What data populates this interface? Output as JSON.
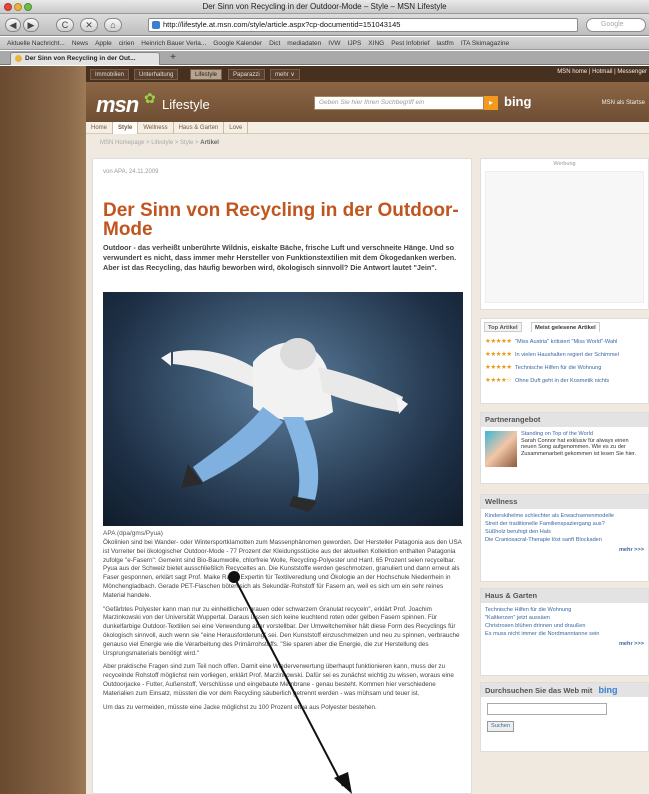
{
  "window": {
    "title": "Der Sinn von Recycling in der Outdoor-Mode – Style – MSN Lifestyle"
  },
  "toolbar": {
    "back": "◀",
    "forward": "▶",
    "reload": "C",
    "stop": "✕",
    "home": "⌂",
    "url": "http://lifestyle.at.msn.com/style/article.aspx?cp-documentid=151043145",
    "search_placeholder": "Google"
  },
  "bookmarks": [
    "Aktuelle Nachricht...",
    "News",
    "Apple",
    "cirien",
    "Heinrich Bauer Verla...",
    "Google Kalender",
    "Dict",
    "mediadaten",
    "IVW",
    "IJPS",
    "XING",
    "Pest Infobrief",
    "lastfm",
    "ITA Skimagazine"
  ],
  "tab": {
    "label": "Der Sinn von Recycling in der Out...",
    "new_tab": "+"
  },
  "msn": {
    "top_nav": [
      "Immobilien",
      "Unterhaltung",
      "Lifestyle",
      "Paparazzi",
      "mehr ∨"
    ],
    "top_right": "MSN home | Hotmail | Messenger",
    "logo": "msn",
    "lifestyle": "Lifestyle",
    "search_placeholder": "Geben Sie hier Ihren Suchbegriff ein",
    "search_btn": "▸",
    "bing": "bing",
    "start_page": "MSN als Startse",
    "sub_nav": [
      "Home",
      "Style",
      "Wellness",
      "Haus & Garten",
      "Love"
    ],
    "breadcrumbs": "MSN Homepage  >  Lifestyle  >  Style  >",
    "breadcrumb_current": "Artikel"
  },
  "article": {
    "byline": "von APA, 24.11.2009",
    "title": "Der Sinn von Recycling in der Outdoor-Mode",
    "lead": "Outdoor - das verheißt unberührte Wildnis, eiskalte Bäche, frische Luft und verschneite Hänge. Und so verwundert es nicht, dass immer mehr Hersteller von Funktionstextilien mit dem Ökogedanken werben. Aber ist das Recycling, das häufig beworben wird, ökologisch sinnvoll? Die Antwort lautet \"Jein\".",
    "caption": "APA (dpa/gms/Pyua)",
    "p1": "Ökolinien sind bei Wander- oder Wintersportklamotten zum Massenphänomen geworden. Der Hersteller Patagonia aus den USA ist Vorreiter bei ökologischer Outdoor-Mode - 77 Prozent der Kleidungsstücke aus der aktuellen Kollektion enthalten Patagonia zufolge \"e-Fasern\": Gemeint sind Bio-Baumwolle, chlorfreie Wolle, Recycling-Polyester und Hanf. 65 Prozent seien recycelbar. Pyua aus der Schweiz bietet ausschließlich Recyceltes an. Die Kunststoffe werden geschmolzen, granuliert und dann erneut als Faser gesponnen, erklärt sagt Prof. Maike Rabe, Expertin für Textilveredlung und Ökologie an der Hochschule Niederrhein in Mönchengladbach. Gerade PET-Flaschen böten sich als Sekundär-Rohstoff für Fasern an, weil es sich um ein sehr reines Material handele.",
    "p2": "\"Gefärbtes Polyester kann man nur zu einheitlichem grauen oder schwarzem Granulat recyceln\", erklärt Prof. Joachim Marzinkowski von der Universität Wuppertal. Daraus lassen sich keine leuchtend roten oder gelben Fasern spinnen. Für dunkelfarbige Outdoor-Textilien sei eine Verwendung aber vorstellbar. Der Umweltchemiker hält diese Form des Recyclings für ökologisch sinnvoll, auch wenn sie \"eine Herausforderung\" sei. Den Kunststoff einzuschmelzen und neu zu spinnen, verbrauche genauso viel Energie wie die Verarbeitung des Primärrohstoffs. \"Sie sparen aber die Energie, die zur Herstellung des Ursprungsmaterials benötigt wird.\"",
    "p3": "Aber praktische Fragen sind zum Teil noch offen. Damit eine Wiederverwertung überhaupt funktionieren kann, muss der zu recycelnde Rohstoff möglichst rein vorliegen, erklärt Prof. Marzinkowski. Dafür sei es zunächst wichtig zu wissen, woraus eine Outdoorjacke - Futter, Außenstoff, Verschlüsse und eingebaute Membrane - genau besteht. Kommen hier verschiedene Materialien zum Einsatz, müssten die vor dem Recycling säuberlich getrennt werden - was mühsam und teuer ist.",
    "p4": "Um das zu vermeiden, müsste eine Jacke möglichst zu 100 Prozent etwa aus Polyester bestehen."
  },
  "sidebar": {
    "ad_label": "Werbung",
    "tabs": [
      "Top Artikel",
      "Meist gelesene Artikel"
    ],
    "top_items": [
      {
        "stars": "★★★★★",
        "text": "\"Miss Austria\" kritisiert \"Miss World\"-Wahl"
      },
      {
        "stars": "★★★★★",
        "text": "In vielen Haushalten regiert der Schimmel"
      },
      {
        "stars": "★★★★★",
        "text": "Technische Hilfen für die Wohnung"
      },
      {
        "stars": "★★★★☆",
        "text": "Ohne Duft geht in der Kosmetik nichts"
      }
    ],
    "partner": {
      "title": "Partnerangebot",
      "link": "Standing on Top of the World",
      "text": "Sarah Connor hat exklusiv für always einen neuen Song aufgenommen. Wie es zu der Zusammenarbeit gekommen ist lesen Sie hier."
    },
    "wellness": {
      "title": "Wellness",
      "items": [
        "Kinderskihelme schlechter als Erwachsenenmodelle",
        "Streit der traditionelle Familienspaziergang aus?",
        "Süßholz beruhigt den Hals",
        "Die Craniosacral-Therapie löst sanft Blockaden"
      ],
      "more": "mehr >>>"
    },
    "haus": {
      "title": "Haus & Garten",
      "items": [
        "Technische Hilfen für die Wohnung",
        "\"Kaltkerzen\" jetzt aussäen",
        "Christrosen blühen drinnen und draußen",
        "Es muss nicht immer die Nordmanntanne sein"
      ],
      "more": "mehr >>>"
    },
    "web": {
      "title": "Durchsuchen Sie das Web mit",
      "bing": "bing",
      "button": "Suchen"
    }
  }
}
